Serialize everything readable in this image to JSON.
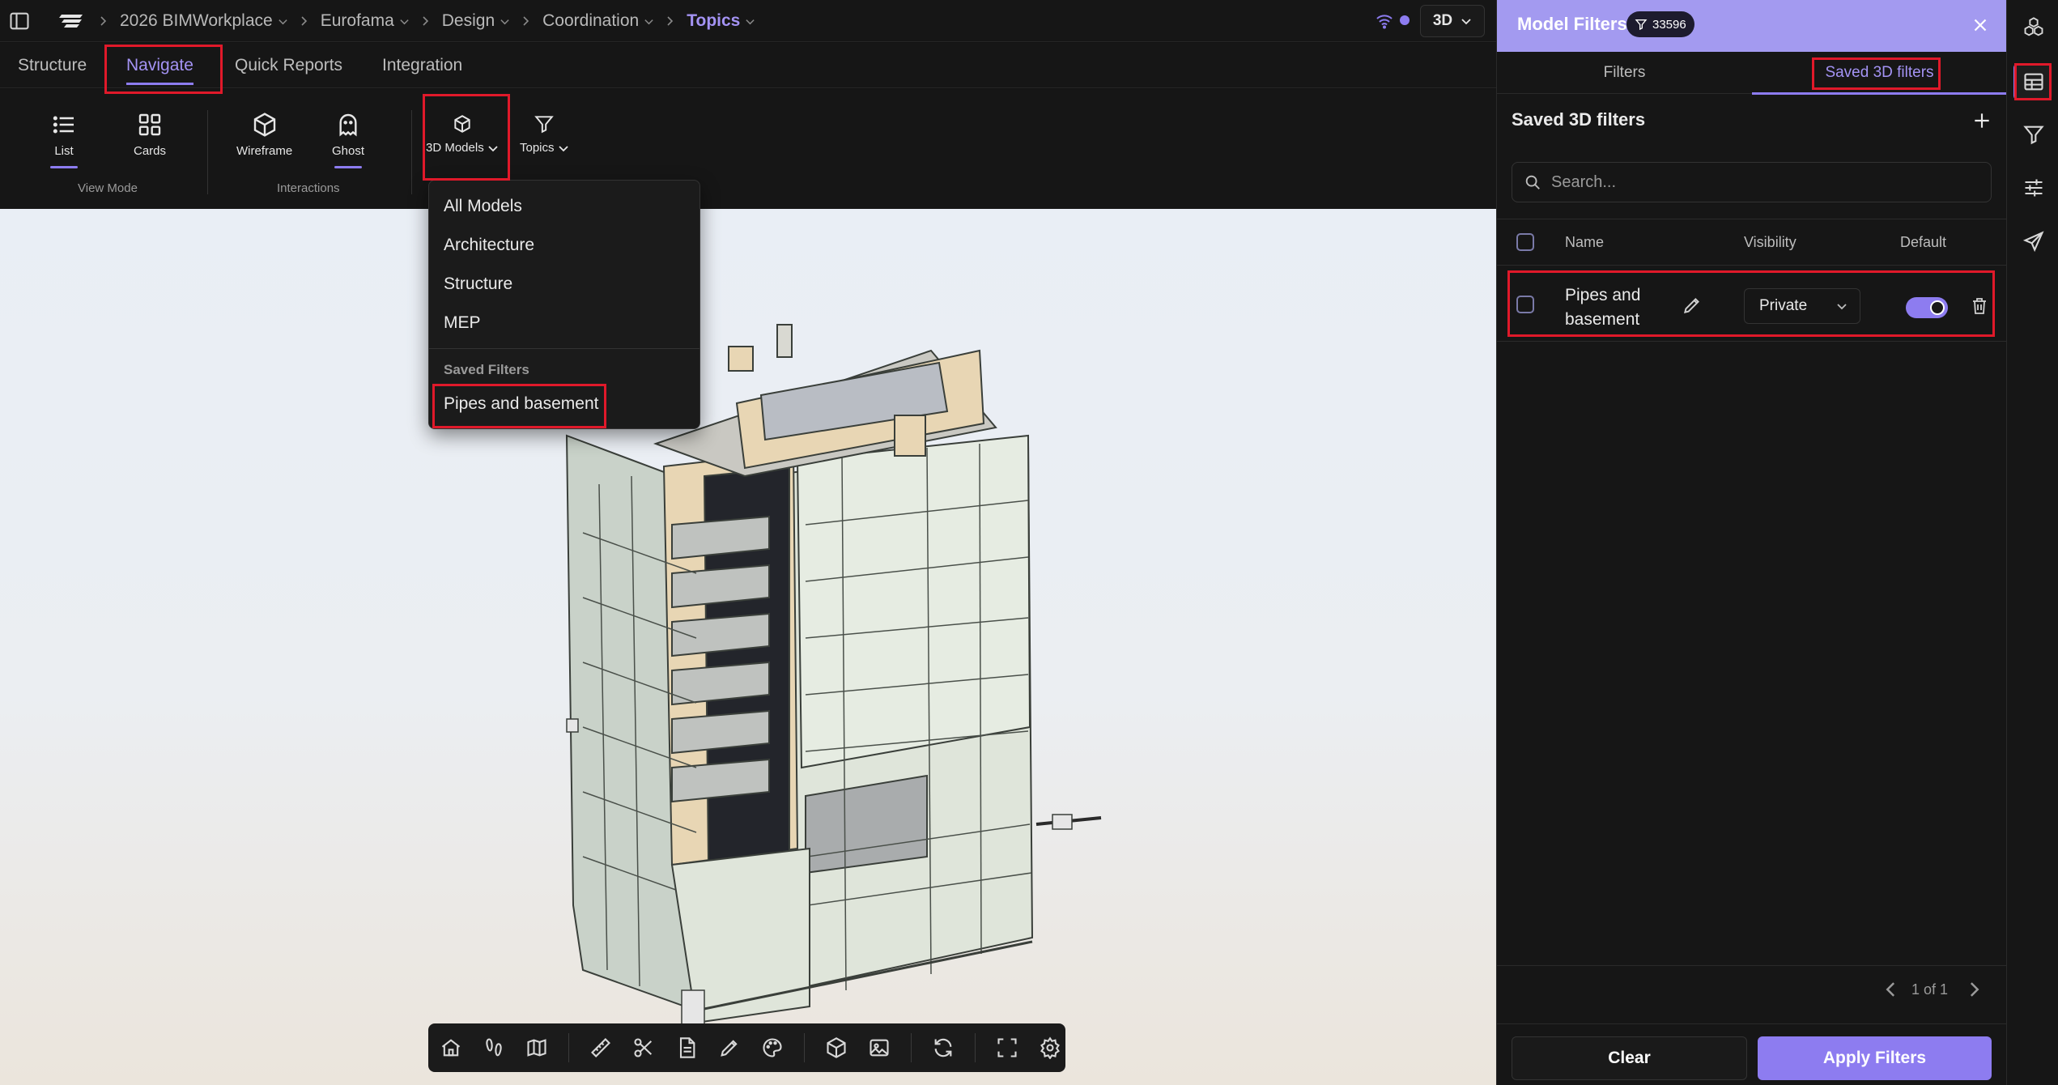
{
  "breadcrumb": {
    "items": [
      {
        "label": "2026 BIMWorkplace",
        "active": false
      },
      {
        "label": "Eurofama",
        "active": false
      },
      {
        "label": "Design",
        "active": false
      },
      {
        "label": "Coordination",
        "active": false
      },
      {
        "label": "Topics",
        "active": true
      }
    ],
    "view_mode": "3D"
  },
  "tabs": [
    "Structure",
    "Navigate",
    "Quick Reports",
    "Integration"
  ],
  "active_tab": "Navigate",
  "toolbar": {
    "list": "List",
    "cards": "Cards",
    "view_mode_group": "View Mode",
    "wireframe": "Wireframe",
    "ghost": "Ghost",
    "interactions_group": "Interactions",
    "models": "3D Models",
    "topics": "Topics"
  },
  "models_dropdown": {
    "items": [
      "All Models",
      "Architecture",
      "Structure",
      "MEP"
    ],
    "saved_header": "Saved Filters",
    "saved_items": [
      "Pipes and basement"
    ]
  },
  "bottom_toolbar": {
    "icons": [
      "home-icon",
      "walk-icon",
      "map-icon",
      "ruler-icon",
      "scissors-icon",
      "document-icon",
      "pen-icon",
      "palette-icon",
      "cube-icon",
      "image-icon",
      "refresh-icon",
      "fullscreen-icon",
      "settings-icon"
    ]
  },
  "panel": {
    "title": "Model Filters",
    "count": "33596",
    "tabs": [
      "Filters",
      "Saved 3D filters"
    ],
    "active_tab": "Saved 3D filters",
    "section_title": "Saved 3D filters",
    "search_placeholder": "Search...",
    "columns": {
      "name": "Name",
      "visibility": "Visibility",
      "default": "Default"
    },
    "rows": [
      {
        "name": "Pipes and basement",
        "visibility": "Private",
        "default": true
      }
    ],
    "pagination": "1 of 1",
    "clear_label": "Clear",
    "apply_label": "Apply Filters"
  },
  "colors": {
    "accent": "#8d7cf0",
    "header": "#a39af0",
    "highlight": "#e0192a",
    "background": "#161616"
  },
  "rail_icons": [
    "cubes-icon",
    "table-icon",
    "filter-icon",
    "sliders-icon",
    "send-icon"
  ]
}
